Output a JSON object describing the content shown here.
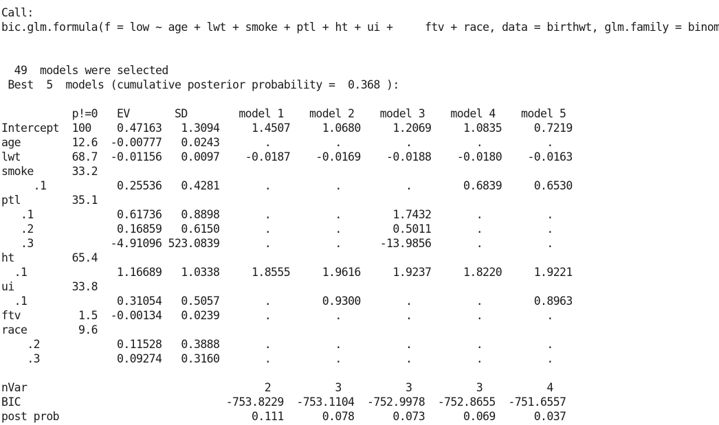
{
  "output_lines": [
    "Call:",
    "bic.glm.formula(f = low ~ age + lwt + smoke + ptl + ht + ui +     ftv + race, data = birthwt, glm.family = binomial)",
    "",
    "",
    "  49  models were selected",
    " Best  5  models (cumulative posterior probability =  0.368 ):",
    "",
    "           p!=0   EV       SD        model 1    model 2    model 3    model 4    model 5",
    "Intercept  100    0.47163   1.3094     1.4507     1.0680     1.2069     1.0835     0.7219",
    "age        12.6  -0.00777   0.0243       .          .          .          .          .",
    "lwt        68.7  -0.01156   0.0097    -0.0187    -0.0169    -0.0188    -0.0180    -0.0163",
    "smoke      33.2",
    "     .1           0.25536   0.4281       .          .          .        0.6839     0.6530",
    "ptl        35.1",
    "   .1             0.61736   0.8898       .          .        1.7432       .          .",
    "   .2             0.16859   0.6150       .          .        0.5011       .          .",
    "   .3            -4.91096 523.0839       .          .      -13.9856       .          .",
    "ht         65.4",
    "  .1              1.16689   1.0338     1.8555     1.9616     1.9237     1.8220     1.9221",
    "ui         33.8",
    "  .1              0.31054   0.5057       .        0.9300       .          .        0.8963",
    "ftv         1.5  -0.00134   0.0239       .          .          .          .          .",
    "race        9.6",
    "    .2            0.11528   0.3888       .          .          .          .          .",
    "    .3            0.09274   0.3160       .          .          .          .          .",
    "",
    "nVar                                     2          3          3          3          4",
    "BIC                                -753.8229  -753.1104  -752.9978  -752.8655  -751.6557",
    "post prob                              0.111      0.078      0.073      0.069      0.037"
  ]
}
